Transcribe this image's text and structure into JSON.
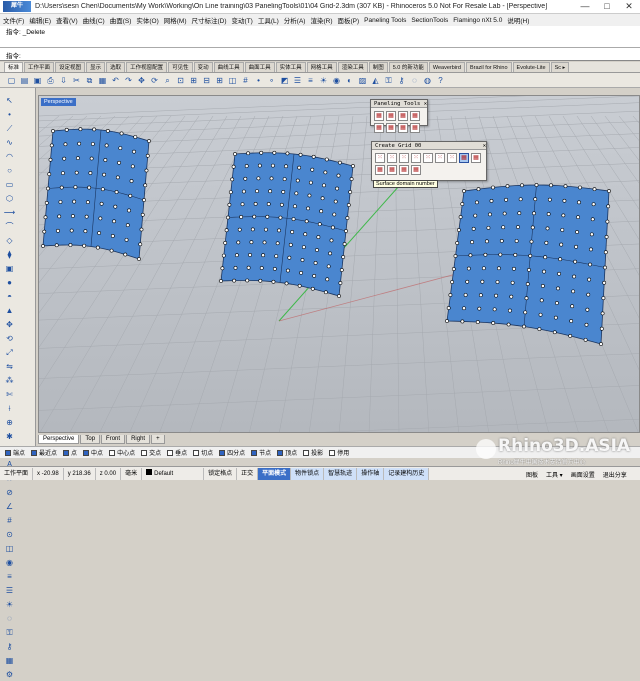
{
  "window": {
    "logo_text": "犀牛",
    "title": "D:\\Users\\sesn Chen\\Documents\\My Work\\Working\\On Line training\\03 PanelingTools\\01\\04 Grid-2.3dm (307 KB) - Rhinoceros 5.0 Not For Resale Lab - [Perspective]",
    "controls": [
      "—",
      "□",
      "✕"
    ]
  },
  "menu": [
    "文件(F)",
    "编辑(E)",
    "查看(V)",
    "曲线(C)",
    "曲面(S)",
    "实体(O)",
    "网格(M)",
    "尺寸标注(D)",
    "变动(T)",
    "工具(L)",
    "分析(A)",
    "渲染(R)",
    "面板(P)",
    "Paneling Tools",
    "SectionTools",
    "Flamingo nXt 5.0",
    "说明(H)"
  ],
  "command_history": [
    "指令: _Delete"
  ],
  "command_prompt": "指令:",
  "toolbar_tabs": [
    "标准",
    "工作平面",
    "设定视图",
    "显示",
    "选取",
    "工作视窗配置",
    "可见性",
    "变动",
    "曲线工具",
    "曲面工具",
    "实体工具",
    "网格工具",
    "渲染工具",
    "制图",
    "5.0 的新功能",
    "Weaverbird",
    "Brazil for Rhino",
    "Evolute-Lite",
    "Sc ▸"
  ],
  "toolbar_icons": [
    "new-file",
    "open",
    "save",
    "print",
    "import",
    "cut",
    "copy",
    "paste",
    "undo",
    "redo",
    "pan",
    "rotate-view",
    "zoom",
    "zoom-window",
    "zoom-extents",
    "zoom-selected",
    "four-views",
    "set-view",
    "grid",
    "points-on",
    "points-off",
    "select-all",
    "properties",
    "layer",
    "light",
    "render",
    "material",
    "texture",
    "mesh",
    "lock",
    "unlock",
    "hide",
    "show",
    "help"
  ],
  "left_tools": [
    "select",
    "point",
    "polyline",
    "curve",
    "arc",
    "circle",
    "rectangle",
    "polygon",
    "extend",
    "fillet",
    "surface",
    "loft",
    "box",
    "sphere",
    "boolean",
    "extrude",
    "move",
    "rotate",
    "scale",
    "mirror",
    "array",
    "trim",
    "split",
    "join",
    "explode",
    "group",
    "text",
    "dimension",
    "section",
    "analyze",
    "grid-snap",
    "osnap",
    "cplane",
    "render",
    "layer",
    "properties",
    "light",
    "hide",
    "lock",
    "unlock",
    "paneling",
    "options"
  ],
  "viewport": {
    "label": "Perspective",
    "bg_top": "#c9cdd3",
    "bg_bottom": "#b4b8be",
    "surface_color": "#4a86cf",
    "tabs": [
      "Perspective",
      "Top",
      "Front",
      "Right",
      "+"
    ]
  },
  "paneling_panel": {
    "title": "Paneling Tools",
    "close": "✕",
    "buttons": [
      "grid-icon",
      "surface-grid-icon",
      "curve-grid-icon",
      "pattern-icon",
      "panel-icon",
      "shape-icon",
      "options-icon",
      "pt-logo-icon"
    ]
  },
  "create_grid_panel": {
    "title": "Create Grid 00",
    "close": "✕",
    "buttons": [
      "rect-grid-icon",
      "polar-grid-icon",
      "curve-grid-icon",
      "surface-grid-icon",
      "sphere-grid-icon",
      "pt-grid-icon",
      "curve-point-icon",
      "surface-domain-number-icon",
      "surface-domain-length-icon",
      "surface-domain-chord-icon",
      "surface-domain-points-icon",
      "surface-uv-icon",
      "surface-isocurve-icon"
    ],
    "tooltip": "Surface domain number"
  },
  "osnaps": [
    {
      "label": "端点",
      "on": true
    },
    {
      "label": "最近点",
      "on": true
    },
    {
      "label": "点",
      "on": true
    },
    {
      "label": "中点",
      "on": true
    },
    {
      "label": "中心点",
      "on": false
    },
    {
      "label": "交点",
      "on": false
    },
    {
      "label": "垂点",
      "on": false
    },
    {
      "label": "切点",
      "on": false
    },
    {
      "label": "四分点",
      "on": true
    },
    {
      "label": "节点",
      "on": true
    },
    {
      "label": "顶点",
      "on": true
    },
    {
      "label": "投影",
      "on": false
    },
    {
      "label": "停用",
      "on": false
    }
  ],
  "status": {
    "cplane": "工作平面",
    "x": "x -20.98",
    "y": "y 218.36",
    "z": "z 0.00",
    "unit": "毫米",
    "layer": "Default",
    "toggles": [
      "锁定格点",
      "正交",
      "平面模式",
      "物件锁点",
      "智慧轨迹",
      "操作轴",
      "记录建构历史"
    ]
  },
  "right_dock": [
    "图板",
    "工具 ▾",
    "画面设置",
    "退出分享"
  ],
  "watermark": {
    "main": "Rhino3D.ASIA",
    "sub": "Rhino犀牛中国技术支持官方中心"
  }
}
